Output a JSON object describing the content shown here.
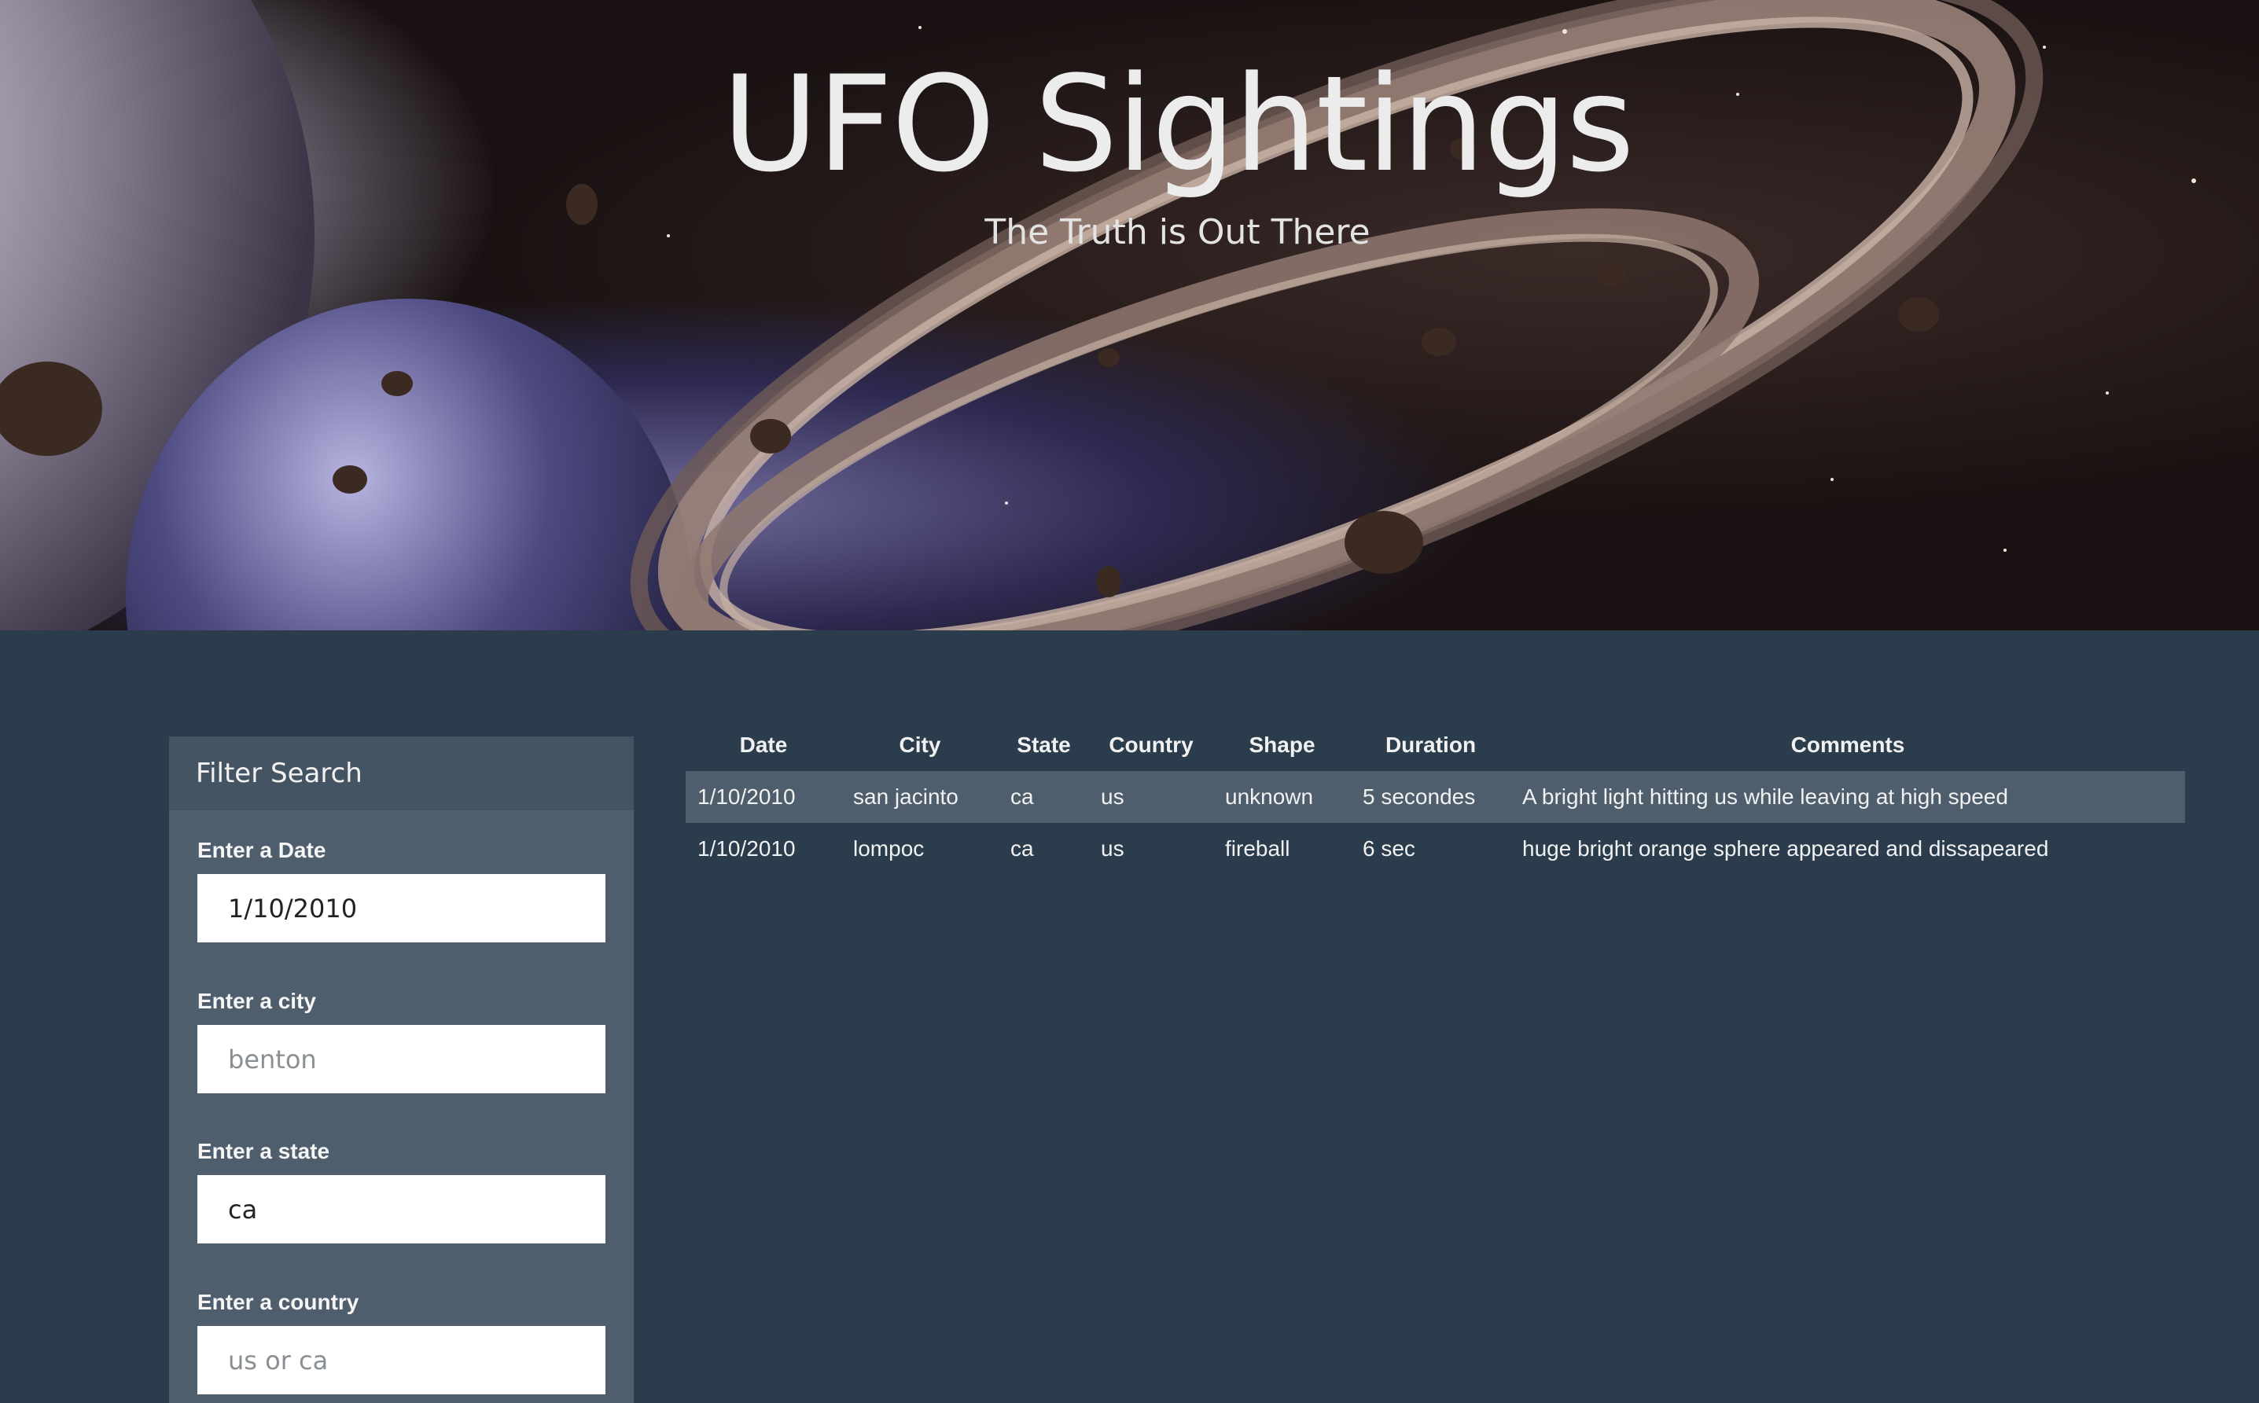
{
  "header": {
    "title": "UFO Sightings",
    "subtitle": "The Truth is Out There"
  },
  "filter": {
    "heading": "Filter Search",
    "fields": [
      {
        "label": "Enter a Date",
        "value": "1/10/2010",
        "placeholder": ""
      },
      {
        "label": "Enter a city",
        "value": "",
        "placeholder": "benton"
      },
      {
        "label": "Enter a state",
        "value": "ca",
        "placeholder": ""
      },
      {
        "label": "Enter a country",
        "value": "",
        "placeholder": "us or ca"
      }
    ]
  },
  "table": {
    "columns": [
      "Date",
      "City",
      "State",
      "Country",
      "Shape",
      "Duration",
      "Comments"
    ],
    "rows": [
      [
        "1/10/2010",
        "san jacinto",
        "ca",
        "us",
        "unknown",
        "5 secondes",
        "A bright light hitting us while leaving at high speed"
      ],
      [
        "1/10/2010",
        "lompoc",
        "ca",
        "us",
        "fireball",
        "6 sec",
        "huge bright orange sphere appeared and dissapeared"
      ]
    ]
  },
  "colors": {
    "page_background": "#2b3c4d",
    "sidebar_background": "#4f5e6c",
    "sidebar_header_background": "#455463",
    "striped_row": "#4f5e6c"
  }
}
